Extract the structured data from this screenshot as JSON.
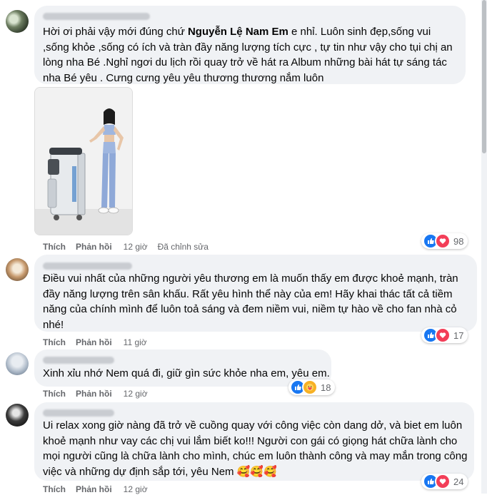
{
  "comments": [
    {
      "text_before": "Hời ơi phải vậy mới đúng chứ ",
      "text_bold": "Nguyễn Lệ Nam Em",
      "text_after": " e nhỉ. Luôn sinh đẹp,sống vui ,sống khỏe ,sống có ích và tràn đầy năng lượng tích cực , tự tin như vậy cho tụi chị an lòng nha Bé .Nghỉ ngơi du lịch rồi quay trở về hát ra Album những bài hát tự sáng tác nha Bé yêu . Cưng cưng yêu yêu thương thương nắm luôn",
      "like_label": "Thích",
      "reply_label": "Phản hồi",
      "time": "12 giờ",
      "edited": "Đã chỉnh sửa",
      "reaction_count": "98",
      "reaction_icons": [
        "like-icon",
        "love-icon"
      ]
    },
    {
      "text": "Điều vui nhất của những người yêu thương em là muốn thấy em được khoẻ mạnh, tràn đầy năng lượng trên sân khấu. Rất yêu hình thể này của em! Hãy khai thác tất cả tiềm năng của chính mình để luôn toả sáng và đem niềm vui, niềm tự hào về cho fan nhà cỏ nhé!",
      "like_label": "Thích",
      "reply_label": "Phản hồi",
      "time": "11 giờ",
      "reaction_count": "17",
      "reaction_icons": [
        "like-icon",
        "love-icon"
      ]
    },
    {
      "text": "Xinh xỉu nhớ Nem quá đi, giữ gìn sức khỏe nha em, yêu em.",
      "like_label": "Thích",
      "reply_label": "Phản hồi",
      "time": "12 giờ",
      "reaction_count": "18",
      "reaction_icons": [
        "like-icon",
        "care-icon"
      ]
    },
    {
      "text": "Ui relax xong giờ nàng đã trở về cuồng quay với công việc còn dang dở, và biet em luôn khoẻ mạnh như vay các chị vui lắm biết ko!!! Người con gái có giọng hát chữa lành cho mọi người cũng là chữa lành cho mình, chúc em luôn thành công và may mắn trong công việc và những dự định sắp tới, yêu Nem 🥰🥰🥰",
      "like_label": "Thích",
      "reply_label": "Phản hồi",
      "time": "12 giờ",
      "reaction_count": "24",
      "reaction_icons": [
        "like-icon",
        "love-icon"
      ]
    }
  ],
  "colors": {
    "bubble": "#f0f2f5",
    "meta_text": "#65676b",
    "like_blue": "#1877f2",
    "love_red": "#f33e58",
    "care_yellow": "#f7b125"
  }
}
